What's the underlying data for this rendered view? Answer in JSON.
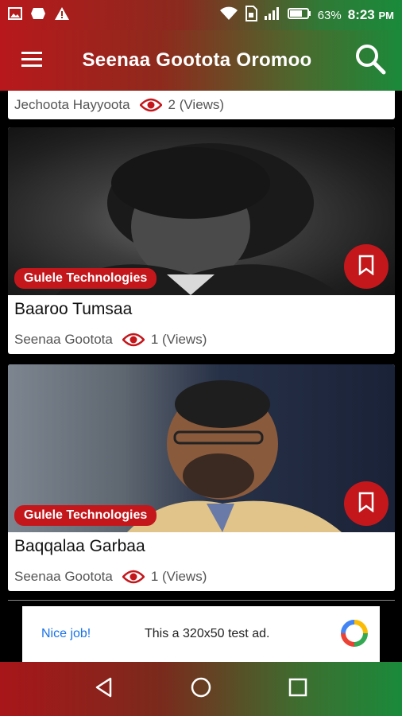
{
  "status_bar": {
    "battery_percent": "63%",
    "time": "8:23",
    "time_suffix": "PM"
  },
  "app_bar": {
    "title": "Seenaa Gootota Oromoo",
    "menu_icon": "hamburger-menu-icon",
    "search_icon": "search-icon"
  },
  "cards": [
    {
      "author": "Jechoota Hayyoota",
      "views": "2 (Views)"
    },
    {
      "tag": "Gulele Technologies",
      "title": "Baaroo Tumsaa",
      "author": "Seenaa Gootota",
      "views": "1 (Views)"
    },
    {
      "tag": "Gulele Technologies",
      "title": "Baqqalaa Garbaa",
      "author": "Seenaa Gootota",
      "views": "1 (Views)"
    }
  ],
  "ad": {
    "nice": "Nice job!",
    "text": "This a 320x50 test ad."
  },
  "colors": {
    "accent_red": "#c4171c",
    "accent_green": "#1a8a3a"
  }
}
